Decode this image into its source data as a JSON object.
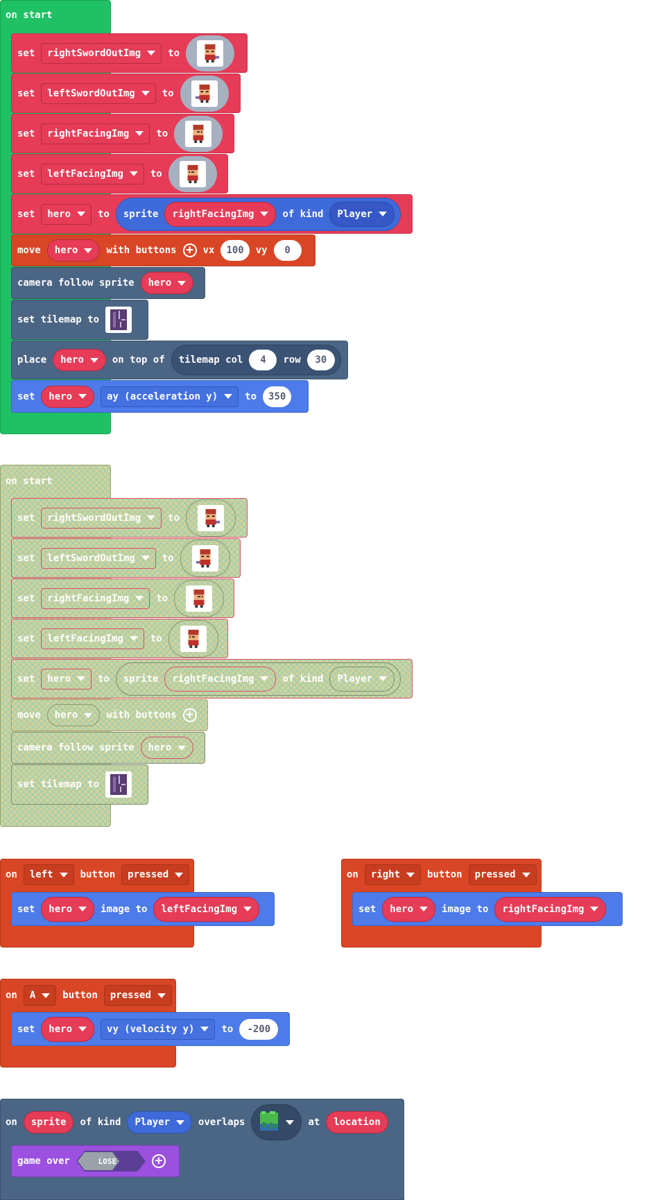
{
  "colors": {
    "variables": "#e63c58",
    "scene": "#4b6584",
    "sprites": "#4e7bea",
    "controller": "#d94625",
    "loops": "#20c064",
    "game": "#9b50e0"
  },
  "on_start_1": {
    "hat": "on start",
    "rows": [
      {
        "kw": "set",
        "var": "rightSwordOutImg",
        "to": "to",
        "icon": "hero-sword-right-image"
      },
      {
        "kw": "set",
        "var": "leftSwordOutImg",
        "to": "to",
        "icon": "hero-sword-left-image"
      },
      {
        "kw": "set",
        "var": "rightFacingImg",
        "to": "to",
        "icon": "hero-facing-right-image"
      },
      {
        "kw": "set",
        "var": "leftFacingImg",
        "to": "to",
        "icon": "hero-facing-left-image"
      }
    ],
    "set_hero": {
      "kw": "set",
      "var": "hero",
      "to": "to",
      "sprite": "sprite",
      "img_var": "rightFacingImg",
      "of_kind": "of kind",
      "kind": "Player"
    },
    "move": {
      "kw": "move",
      "var": "hero",
      "with_buttons": "with buttons",
      "vx_label": "vx",
      "vx": "100",
      "vy_label": "vy",
      "vy": "0"
    },
    "camera": {
      "kw": "camera follow sprite",
      "var": "hero"
    },
    "tilemap": {
      "kw": "set tilemap to",
      "icon": "tilemap-image"
    },
    "place": {
      "kw": "place",
      "var": "hero",
      "on_top": "on top of",
      "tilemap_col": "tilemap col",
      "col": "4",
      "row_label": "row",
      "row": "30"
    },
    "accel": {
      "kw": "set",
      "var": "hero",
      "prop": "ay (acceleration y)",
      "to": "to",
      "value": "350"
    }
  },
  "on_start_2": {
    "hat": "on start",
    "rows": [
      {
        "kw": "set",
        "var": "rightSwordOutImg",
        "to": "to"
      },
      {
        "kw": "set",
        "var": "leftSwordOutImg",
        "to": "to"
      },
      {
        "kw": "set",
        "var": "rightFacingImg",
        "to": "to"
      },
      {
        "kw": "set",
        "var": "leftFacingImg",
        "to": "to"
      }
    ],
    "set_hero": {
      "kw": "set",
      "var": "hero",
      "to": "to",
      "sprite": "sprite",
      "img_var": "rightFacingImg",
      "of_kind": "of kind",
      "kind": "Player"
    },
    "move": {
      "kw": "move",
      "var": "hero",
      "with_buttons": "with buttons"
    },
    "camera": {
      "kw": "camera follow sprite",
      "var": "hero"
    },
    "tilemap": {
      "kw": "set tilemap to"
    }
  },
  "on_left": {
    "on": "on",
    "button": "left",
    "button_label": "button",
    "event": "pressed",
    "set": "set",
    "var": "hero",
    "image_to": "image to",
    "img_var": "leftFacingImg"
  },
  "on_right": {
    "on": "on",
    "button": "right",
    "button_label": "button",
    "event": "pressed",
    "set": "set",
    "var": "hero",
    "image_to": "image to",
    "img_var": "rightFacingImg"
  },
  "on_a": {
    "on": "on",
    "button": "A",
    "button_label": "button",
    "event": "pressed",
    "set": "set",
    "var": "hero",
    "prop": "vy (velocity y)",
    "to": "to",
    "value": "-200"
  },
  "overlap": {
    "on": "on",
    "sprite": "sprite",
    "of_kind": "of kind",
    "kind": "Player",
    "overlaps": "overlaps",
    "tile_icon": "grass-tile-image",
    "at": "at",
    "location": "location",
    "game_over": "game over",
    "lose": "LOSE"
  }
}
